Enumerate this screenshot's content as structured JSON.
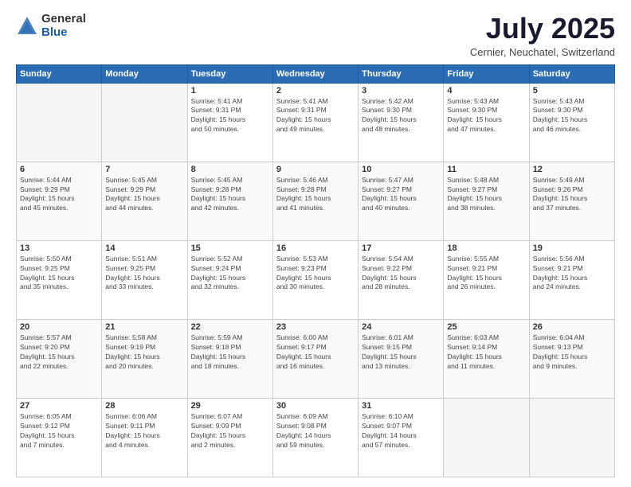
{
  "header": {
    "logo_general": "General",
    "logo_blue": "Blue",
    "month_title": "July 2025",
    "location": "Cernier, Neuchatel, Switzerland"
  },
  "weekdays": [
    "Sunday",
    "Monday",
    "Tuesday",
    "Wednesday",
    "Thursday",
    "Friday",
    "Saturday"
  ],
  "weeks": [
    [
      {
        "day": "",
        "info": ""
      },
      {
        "day": "",
        "info": ""
      },
      {
        "day": "1",
        "info": "Sunrise: 5:41 AM\nSunset: 9:31 PM\nDaylight: 15 hours\nand 50 minutes."
      },
      {
        "day": "2",
        "info": "Sunrise: 5:41 AM\nSunset: 9:31 PM\nDaylight: 15 hours\nand 49 minutes."
      },
      {
        "day": "3",
        "info": "Sunrise: 5:42 AM\nSunset: 9:30 PM\nDaylight: 15 hours\nand 48 minutes."
      },
      {
        "day": "4",
        "info": "Sunrise: 5:43 AM\nSunset: 9:30 PM\nDaylight: 15 hours\nand 47 minutes."
      },
      {
        "day": "5",
        "info": "Sunrise: 5:43 AM\nSunset: 9:30 PM\nDaylight: 15 hours\nand 46 minutes."
      }
    ],
    [
      {
        "day": "6",
        "info": "Sunrise: 5:44 AM\nSunset: 9:29 PM\nDaylight: 15 hours\nand 45 minutes."
      },
      {
        "day": "7",
        "info": "Sunrise: 5:45 AM\nSunset: 9:29 PM\nDaylight: 15 hours\nand 44 minutes."
      },
      {
        "day": "8",
        "info": "Sunrise: 5:45 AM\nSunset: 9:28 PM\nDaylight: 15 hours\nand 42 minutes."
      },
      {
        "day": "9",
        "info": "Sunrise: 5:46 AM\nSunset: 9:28 PM\nDaylight: 15 hours\nand 41 minutes."
      },
      {
        "day": "10",
        "info": "Sunrise: 5:47 AM\nSunset: 9:27 PM\nDaylight: 15 hours\nand 40 minutes."
      },
      {
        "day": "11",
        "info": "Sunrise: 5:48 AM\nSunset: 9:27 PM\nDaylight: 15 hours\nand 38 minutes."
      },
      {
        "day": "12",
        "info": "Sunrise: 5:49 AM\nSunset: 9:26 PM\nDaylight: 15 hours\nand 37 minutes."
      }
    ],
    [
      {
        "day": "13",
        "info": "Sunrise: 5:50 AM\nSunset: 9:25 PM\nDaylight: 15 hours\nand 35 minutes."
      },
      {
        "day": "14",
        "info": "Sunrise: 5:51 AM\nSunset: 9:25 PM\nDaylight: 15 hours\nand 33 minutes."
      },
      {
        "day": "15",
        "info": "Sunrise: 5:52 AM\nSunset: 9:24 PM\nDaylight: 15 hours\nand 32 minutes."
      },
      {
        "day": "16",
        "info": "Sunrise: 5:53 AM\nSunset: 9:23 PM\nDaylight: 15 hours\nand 30 minutes."
      },
      {
        "day": "17",
        "info": "Sunrise: 5:54 AM\nSunset: 9:22 PM\nDaylight: 15 hours\nand 28 minutes."
      },
      {
        "day": "18",
        "info": "Sunrise: 5:55 AM\nSunset: 9:21 PM\nDaylight: 15 hours\nand 26 minutes."
      },
      {
        "day": "19",
        "info": "Sunrise: 5:56 AM\nSunset: 9:21 PM\nDaylight: 15 hours\nand 24 minutes."
      }
    ],
    [
      {
        "day": "20",
        "info": "Sunrise: 5:57 AM\nSunset: 9:20 PM\nDaylight: 15 hours\nand 22 minutes."
      },
      {
        "day": "21",
        "info": "Sunrise: 5:58 AM\nSunset: 9:19 PM\nDaylight: 15 hours\nand 20 minutes."
      },
      {
        "day": "22",
        "info": "Sunrise: 5:59 AM\nSunset: 9:18 PM\nDaylight: 15 hours\nand 18 minutes."
      },
      {
        "day": "23",
        "info": "Sunrise: 6:00 AM\nSunset: 9:17 PM\nDaylight: 15 hours\nand 16 minutes."
      },
      {
        "day": "24",
        "info": "Sunrise: 6:01 AM\nSunset: 9:15 PM\nDaylight: 15 hours\nand 13 minutes."
      },
      {
        "day": "25",
        "info": "Sunrise: 6:03 AM\nSunset: 9:14 PM\nDaylight: 15 hours\nand 11 minutes."
      },
      {
        "day": "26",
        "info": "Sunrise: 6:04 AM\nSunset: 9:13 PM\nDaylight: 15 hours\nand 9 minutes."
      }
    ],
    [
      {
        "day": "27",
        "info": "Sunrise: 6:05 AM\nSunset: 9:12 PM\nDaylight: 15 hours\nand 7 minutes."
      },
      {
        "day": "28",
        "info": "Sunrise: 6:06 AM\nSunset: 9:11 PM\nDaylight: 15 hours\nand 4 minutes."
      },
      {
        "day": "29",
        "info": "Sunrise: 6:07 AM\nSunset: 9:09 PM\nDaylight: 15 hours\nand 2 minutes."
      },
      {
        "day": "30",
        "info": "Sunrise: 6:09 AM\nSunset: 9:08 PM\nDaylight: 14 hours\nand 59 minutes."
      },
      {
        "day": "31",
        "info": "Sunrise: 6:10 AM\nSunset: 9:07 PM\nDaylight: 14 hours\nand 57 minutes."
      },
      {
        "day": "",
        "info": ""
      },
      {
        "day": "",
        "info": ""
      }
    ]
  ]
}
